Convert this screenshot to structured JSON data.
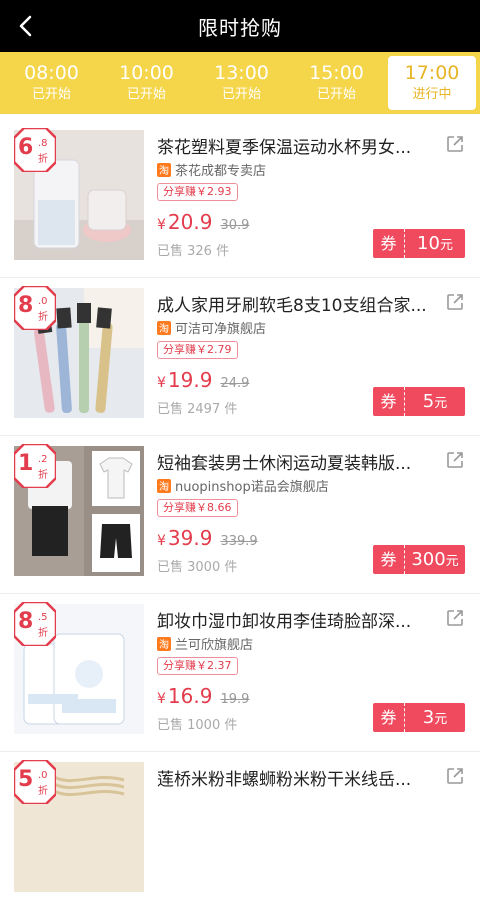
{
  "header": {
    "title": "限时抢购"
  },
  "tabs": [
    {
      "time": "08:00",
      "status": "已开始",
      "active": false
    },
    {
      "time": "10:00",
      "status": "已开始",
      "active": false
    },
    {
      "time": "13:00",
      "status": "已开始",
      "active": false
    },
    {
      "time": "15:00",
      "status": "已开始",
      "active": false
    },
    {
      "time": "17:00",
      "status": "进行中",
      "active": true
    }
  ],
  "colors": {
    "header_bg": "#000000",
    "tab_bar": "#f5d54a",
    "accent": "#e33c4c",
    "coupon": "#f04a5e"
  },
  "products": [
    {
      "discount_int": "6",
      "discount_dec": ".8",
      "discount_unit": "折",
      "name": "茶花塑料夏季保温运动水杯男女...",
      "shop": "茶花成都专卖店",
      "tao": "淘",
      "earn": "分享赚￥2.93",
      "yen": "¥",
      "price": "20.9",
      "old_price": "30.9",
      "sold": "已售 326 件",
      "coupon_label": "券",
      "coupon_amount": "10",
      "coupon_unit": "元"
    },
    {
      "discount_int": "8",
      "discount_dec": ".0",
      "discount_unit": "折",
      "name": "成人家用牙刷软毛8支10支组合家...",
      "shop": "可洁可净旗舰店",
      "tao": "淘",
      "earn": "分享赚￥2.79",
      "yen": "¥",
      "price": "19.9",
      "old_price": "24.9",
      "sold": "已售 2497 件",
      "coupon_label": "券",
      "coupon_amount": "5",
      "coupon_unit": "元"
    },
    {
      "discount_int": "1",
      "discount_dec": ".2",
      "discount_unit": "折",
      "name": "短袖套装男士休闲运动夏装韩版...",
      "shop": "nuopinshop诺品会旗舰店",
      "tao": "淘",
      "earn": "分享赚￥8.66",
      "yen": "¥",
      "price": "39.9",
      "old_price": "339.9",
      "sold": "已售 3000 件",
      "coupon_label": "券",
      "coupon_amount": "300",
      "coupon_unit": "元"
    },
    {
      "discount_int": "8",
      "discount_dec": ".5",
      "discount_unit": "折",
      "name": "卸妆巾湿巾卸妆用李佳琦脸部深...",
      "shop": "兰可欣旗舰店",
      "tao": "淘",
      "earn": "分享赚￥2.37",
      "yen": "¥",
      "price": "16.9",
      "old_price": "19.9",
      "sold": "已售 1000 件",
      "coupon_label": "券",
      "coupon_amount": "3",
      "coupon_unit": "元"
    },
    {
      "discount_int": "5",
      "discount_dec": ".0",
      "discount_unit": "折",
      "name": "莲桥米粉非螺蛳粉米粉干米线岳...",
      "shop": "",
      "tao": "",
      "earn": "",
      "yen": "",
      "price": "",
      "old_price": "",
      "sold": "",
      "coupon_label": "",
      "coupon_amount": "",
      "coupon_unit": ""
    }
  ]
}
